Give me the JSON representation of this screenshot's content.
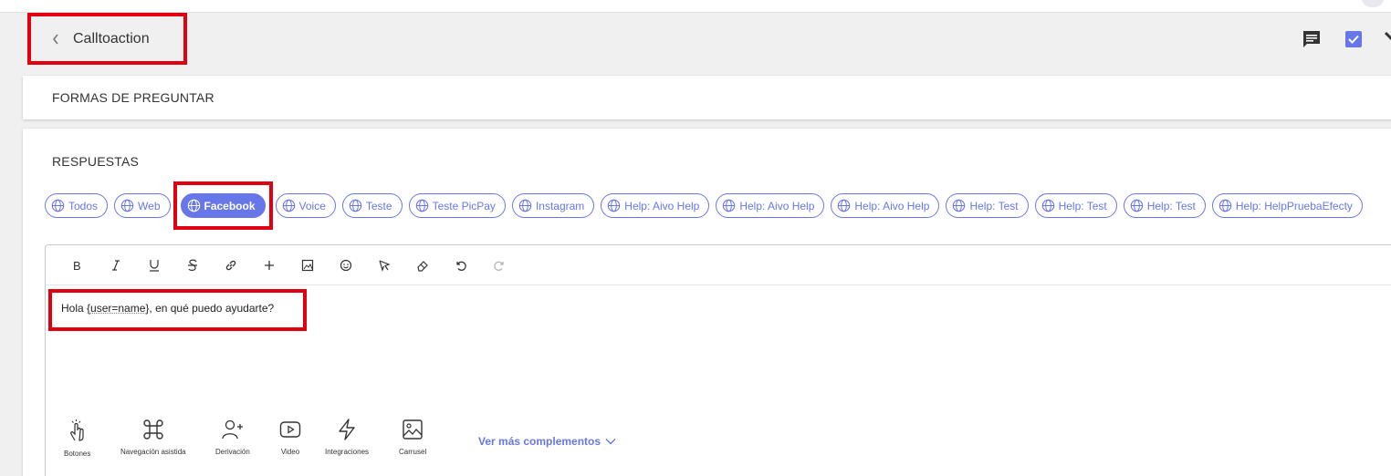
{
  "header": {
    "title": "Calltoaction",
    "icons": [
      "chat-icon",
      "checkbox-icon",
      "tool-icon"
    ]
  },
  "formas": {
    "title": "FORMAS DE PREGUNTAR"
  },
  "respuestas": {
    "title": "RESPUESTAS",
    "channels": [
      {
        "label": "Todos",
        "active": false
      },
      {
        "label": "Web",
        "active": false
      },
      {
        "label": "Facebook",
        "active": true
      },
      {
        "label": "Voice",
        "active": false
      },
      {
        "label": "Teste",
        "active": false
      },
      {
        "label": "Teste PicPay",
        "active": false
      },
      {
        "label": "Instagram",
        "active": false
      },
      {
        "label": "Help: Aivo Help",
        "active": false
      },
      {
        "label": "Help: Aivo Help",
        "active": false
      },
      {
        "label": "Help: Aivo Help",
        "active": false
      },
      {
        "label": "Help: Test",
        "active": false
      },
      {
        "label": "Help: Test",
        "active": false
      },
      {
        "label": "Help: Test",
        "active": false
      },
      {
        "label": "Help: HelpPruebaEfecty",
        "active": false
      }
    ]
  },
  "editor": {
    "toolbar": [
      "bold",
      "italic",
      "underline",
      "strikethrough",
      "link",
      "add",
      "image",
      "emoji",
      "cursor",
      "eraser",
      "undo",
      "redo"
    ],
    "text_before": "Hola ",
    "variable": "{user=name}",
    "text_after": ", en qué puedo ayudarte?"
  },
  "addons": {
    "items": [
      {
        "label": "Botones",
        "icon": "hand-pointer-icon"
      },
      {
        "label": "Navegación asistida",
        "icon": "command-icon"
      },
      {
        "label": "Derivación",
        "icon": "user-plus-icon"
      },
      {
        "label": "Video",
        "icon": "video-icon"
      },
      {
        "label": "Integraciones",
        "icon": "lightning-icon"
      },
      {
        "label": "Carrusel",
        "icon": "image-icon"
      }
    ],
    "more_label": "Ver más complementos"
  },
  "colors": {
    "accent": "#6877e8",
    "highlight": "#e1000f"
  }
}
